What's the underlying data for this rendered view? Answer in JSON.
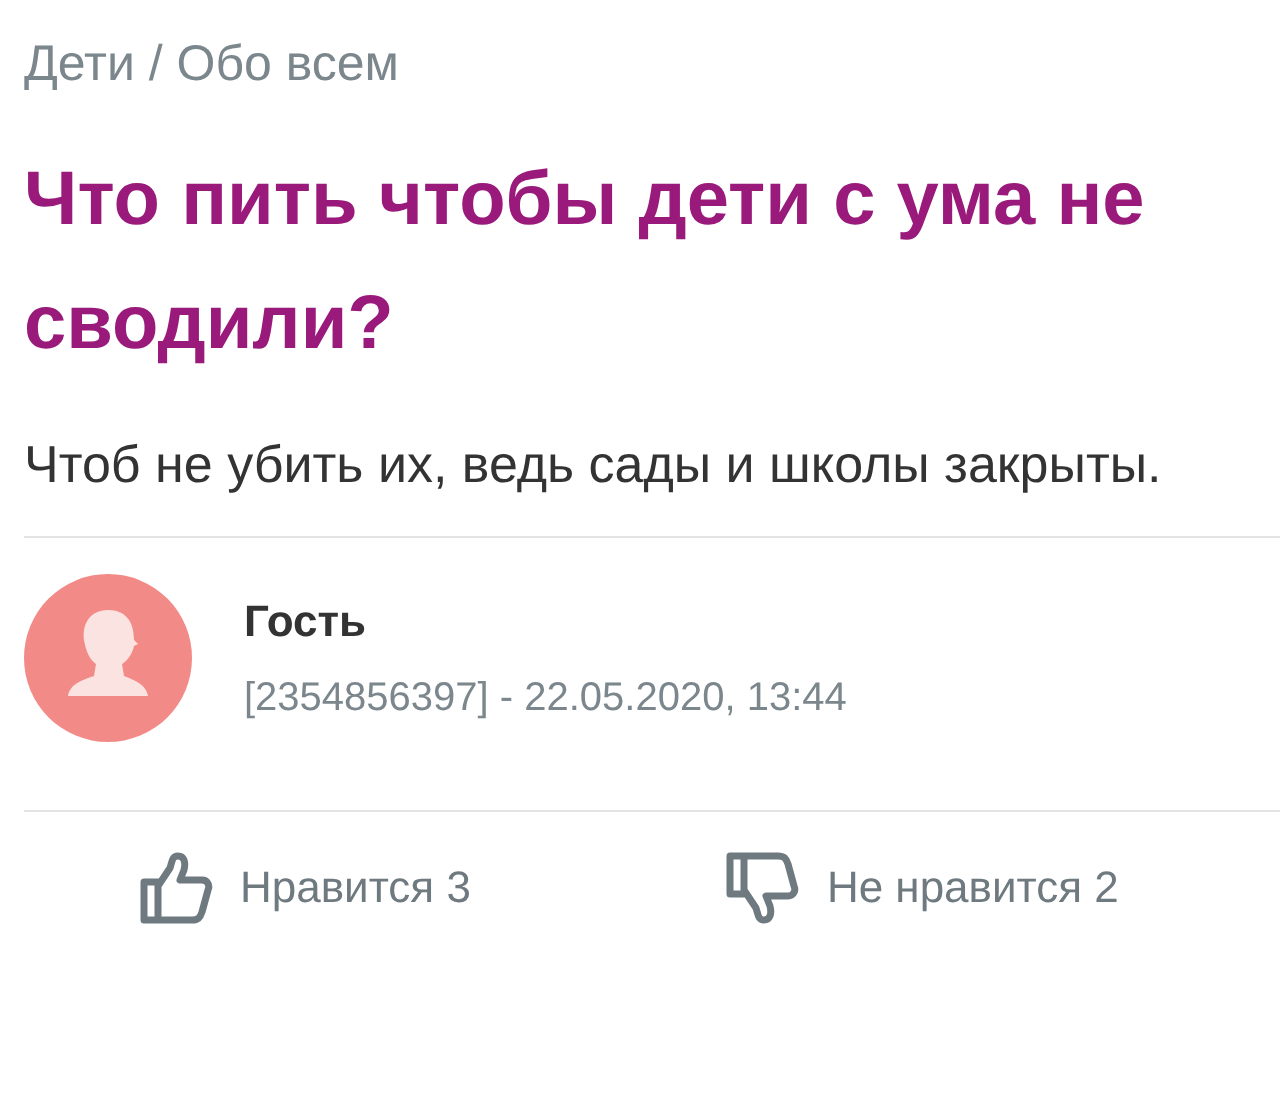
{
  "breadcrumb": "Дети / Обо всем",
  "title": "Что пить чтобы дети с ума не сводили?",
  "body": "Чтоб не убить их, ведь сады и школы закрыты.",
  "author": {
    "name": "Гость",
    "meta": "[2354856397] - 22.05.2020, 13:44"
  },
  "reactions": [
    {
      "kind": "like",
      "label": "Нравится 3"
    },
    {
      "kind": "dislike",
      "label": "Не нравится 2"
    }
  ]
}
